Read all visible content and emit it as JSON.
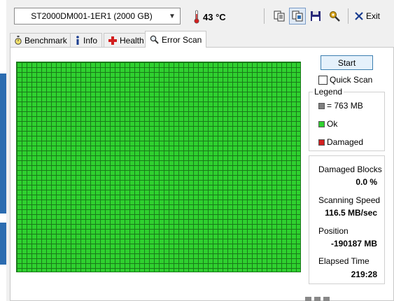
{
  "toolbar": {
    "drive": "ST2000DM001-1ER1 (2000 GB)",
    "temperature": "43 °C",
    "exit_label": "Exit"
  },
  "tabs": [
    {
      "label": "Benchmark",
      "icon": "stopwatch-icon"
    },
    {
      "label": "Info",
      "icon": "info-icon"
    },
    {
      "label": "Health",
      "icon": "health-cross-icon"
    },
    {
      "label": "Error Scan",
      "icon": "magnifier-icon",
      "active": true
    }
  ],
  "scan": {
    "start_label": "Start",
    "quick_scan_label": "Quick Scan",
    "quick_scan_checked": false
  },
  "legend": {
    "title": "Legend",
    "items": [
      {
        "label": "= 763 MB",
        "color": "#808080"
      },
      {
        "label": "Ok",
        "color": "#2fd12f"
      },
      {
        "label": "Damaged",
        "color": "#d21f1f"
      }
    ]
  },
  "stats": {
    "damaged_blocks_label": "Damaged Blocks",
    "damaged_blocks_value": "0.0 %",
    "scanning_speed_label": "Scanning Speed",
    "scanning_speed_value": "116.5 MB/sec",
    "position_label": "Position",
    "position_value": "-190187 MB",
    "elapsed_label": "Elapsed Time",
    "elapsed_value": "219:28"
  },
  "colors": {
    "ok": "#2fd12f",
    "grid_line": "#1a7a1a",
    "damaged": "#d21f1f",
    "accent": "#3c7fb1"
  }
}
